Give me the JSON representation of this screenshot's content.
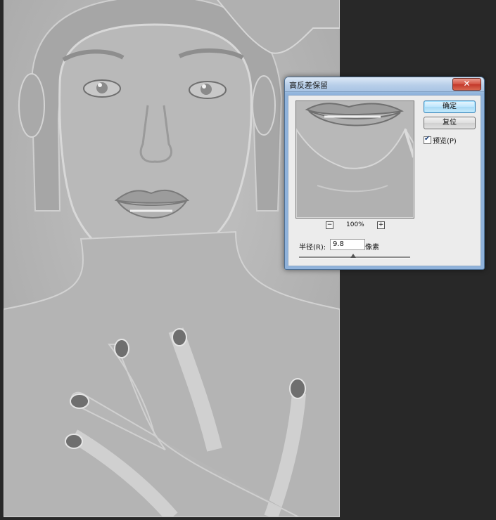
{
  "dialog": {
    "title": "高反差保留",
    "close_label": "✕",
    "ok_label": "确定",
    "reset_label": "复位",
    "preview_label": "预览(P)",
    "preview_checked": true,
    "zoom": {
      "minus_label": "−",
      "value": "100%",
      "plus_label": "+"
    },
    "radius": {
      "label": "半径(R):",
      "value": "9.8",
      "unit": "像素",
      "slider_fraction": 0.49
    }
  },
  "colors": {
    "workspace_bg": "#282828",
    "canvas_gray": "#b5b5b5",
    "default_button": "#bee6fd",
    "close_red": "#d3503f"
  }
}
